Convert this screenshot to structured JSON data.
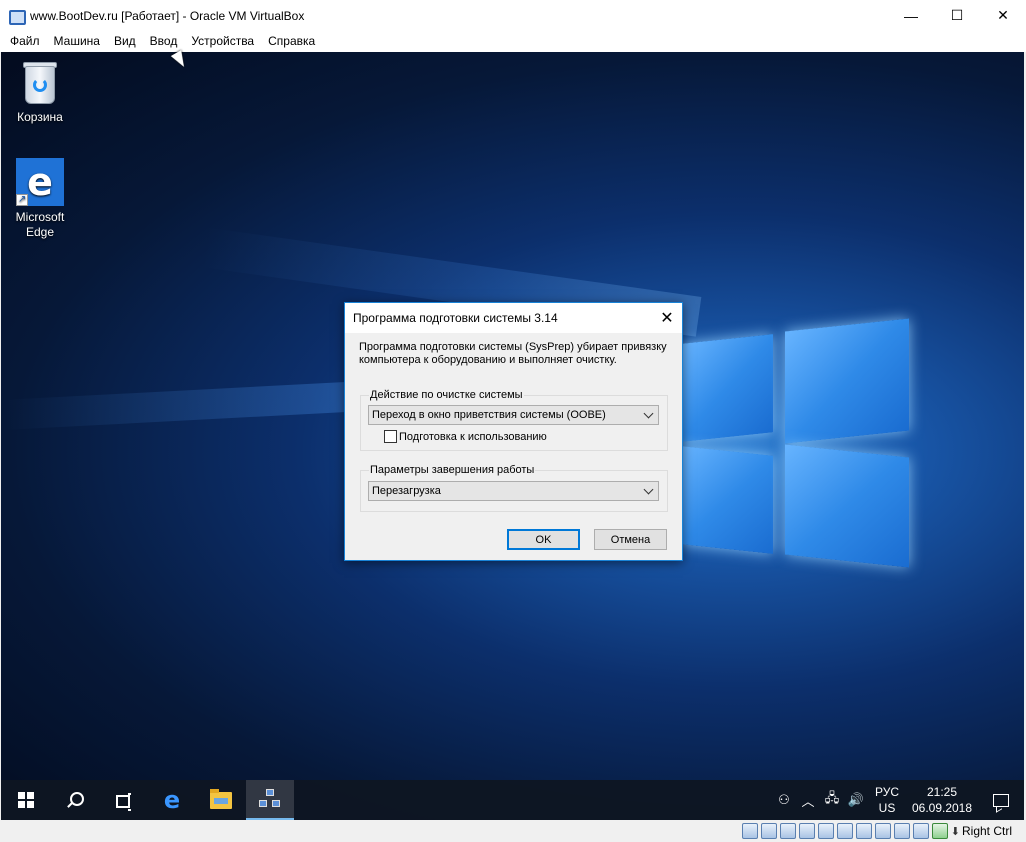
{
  "window": {
    "title": "www.BootDev.ru [Работает] - Oracle VM VirtualBox",
    "minimize": "—",
    "maximize": "☐",
    "close": "✕"
  },
  "menu": [
    "Файл",
    "Машина",
    "Вид",
    "Ввод",
    "Устройства",
    "Справка"
  ],
  "desktop": {
    "icons": [
      {
        "label": "Корзина",
        "icon": "recycle-bin-icon"
      },
      {
        "label": "Microsoft Edge",
        "icon": "edge-icon"
      }
    ]
  },
  "dialog": {
    "title": "Программа подготовки системы 3.14",
    "description": "Программа подготовки системы (SysPrep) убирает привязку компьютера к оборудованию и выполняет очистку.",
    "cleanup_group": {
      "label": "Действие по очистке системы",
      "selected": "Переход в окно приветствия системы (OOBE)",
      "generalize_label": "Подготовка к использованию",
      "generalize_checked": false
    },
    "shutdown_group": {
      "label": "Параметры завершения работы",
      "selected": "Перезагрузка"
    },
    "ok_label": "OK",
    "cancel_label": "Отмена",
    "close": "✕"
  },
  "taskbar": {
    "tray": {
      "people": "⚇",
      "chevron": "︿",
      "network": "🖧",
      "volume": "🔊",
      "lang_top": "РУС",
      "lang_bottom": "US",
      "time": "21:25",
      "date": "06.09.2018"
    }
  },
  "statusbar": {
    "host_key": "Right Ctrl"
  },
  "colors": {
    "accent": "#0078d7",
    "taskbar": "#0e1622"
  }
}
